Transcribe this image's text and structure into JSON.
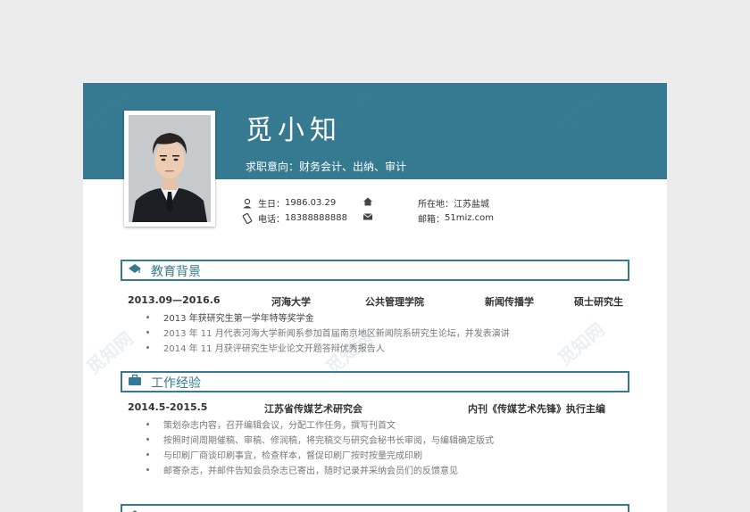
{
  "profile": {
    "name": "觅小知",
    "intent_label": "求职意向：",
    "intent_value": "财务会计、出纳、审计",
    "birthday_label": "生日：",
    "birthday_value": "1986.03.29",
    "phone_label": "电话：",
    "phone_value": "18388888888",
    "location_label": "所在地：",
    "location_value": "江苏盐城",
    "email_label": "邮箱：",
    "email_value": "51miz.com"
  },
  "education": {
    "title": "教育背景",
    "period": "2013.09—2016.6",
    "school": "河海大学",
    "college": "公共管理学院",
    "major": "新闻传播学",
    "degree": "硕士研究生",
    "items": [
      "2013 年获研究生第一学年特等奖学金",
      "2013 年 11 月代表河海大学新闻系参加首届南京地区新闻院系研究生论坛，并发表演讲",
      "2014 年 11 月获评研究生毕业论文开题答辩优秀报告人"
    ]
  },
  "work": {
    "title": "工作经验",
    "period": "2014.5-2015.5",
    "org": "江苏省传媒艺术研究会",
    "role": "内刊《传媒艺术先锋》执行主编",
    "items": [
      "策划杂志内容，召开编辑会议，分配工作任务，撰写刊首文",
      "按照时间周期催稿、审稿、修润稿，将完稿交与研究会秘书长审阅，与编辑确定版式",
      "与印刷厂商谈印刷事宜，检查样本，督促印刷厂按时按量完成印刷",
      "邮寄杂志，并邮件告知会员杂志已寄出，随时记录并采纳会员们的反馈意见"
    ]
  },
  "watermark": {
    "text": "觅知网"
  },
  "colors": {
    "accent": "#357a90"
  }
}
